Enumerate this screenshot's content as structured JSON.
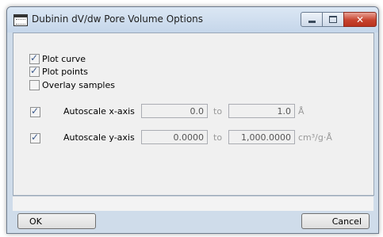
{
  "window": {
    "title": "Dubinin dV/dw Pore Volume Options"
  },
  "options": {
    "plot_curve": {
      "label": "Plot curve",
      "checked": true
    },
    "plot_points": {
      "label": "Plot points",
      "checked": true
    },
    "overlay_samples": {
      "label": "Overlay samples",
      "checked": false
    }
  },
  "x_axis": {
    "label": "Autoscale x-axis",
    "checked": true,
    "from": "0.0",
    "to_label": "to",
    "to": "1.0",
    "unit": "Å"
  },
  "y_axis": {
    "label": "Autoscale y-axis",
    "checked": true,
    "from": "0.0000",
    "to_label": "to",
    "to": "1,000.0000",
    "unit": "cm³/g·Å"
  },
  "buttons": {
    "ok": "OK",
    "cancel": "Cancel"
  },
  "icons": {
    "title": "window-icon",
    "minimize": "minimize-icon",
    "maximize": "maximize-icon",
    "close": "close-icon"
  },
  "colors": {
    "close_button": "#c7432e",
    "titlebar": "#c5d6ea",
    "check": "#3c5a8c"
  }
}
